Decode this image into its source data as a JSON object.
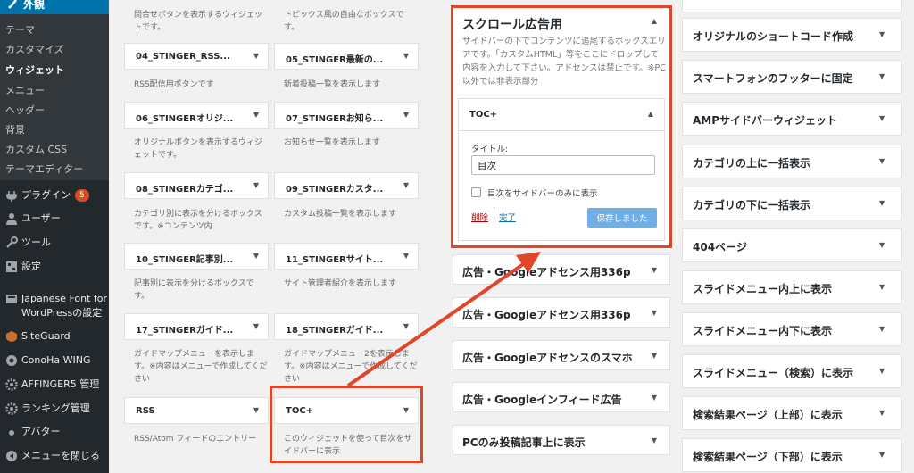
{
  "sidebar": {
    "header": "外観",
    "submenu": [
      "テーマ",
      "カスタマイズ",
      "ウィジェット",
      "メニュー",
      "ヘッダー",
      "背景",
      "カスタム CSS",
      "テーマエディター"
    ],
    "items": [
      {
        "label": "プラグイン",
        "badge": "5"
      },
      {
        "label": "ユーザー"
      },
      {
        "label": "ツール"
      },
      {
        "label": "設定"
      },
      {
        "label": "Japanese Font for",
        "label2": "WordPressの設定"
      },
      {
        "label": "SiteGuard"
      },
      {
        "label": "ConoHa WING"
      },
      {
        "label": "AFFINGER5 管理"
      },
      {
        "label": "ランキング管理"
      },
      {
        "label": "アバター"
      },
      {
        "label": "メニューを閉じる"
      }
    ]
  },
  "available": {
    "top_desc_left": "問合せボタンを表示するウィジェットです。",
    "top_desc_right": "トピックス風の自由なボックスです。",
    "widgets": [
      {
        "title": "04_STINGER_RSS...",
        "desc": "RSS配信用ボタンです"
      },
      {
        "title": "05_STINGER最新の...",
        "desc": "新着投稿一覧を表示します"
      },
      {
        "title": "06_STINGERオリジ...",
        "desc": "オリジナルボタンを表示するウィジェットです。"
      },
      {
        "title": "07_STINGERお知ら...",
        "desc": "お知らせ一覧を表示します"
      },
      {
        "title": "08_STINGERカテゴ...",
        "desc": "カテゴリ別に表示を分けるボックスです。※コンテンツ内"
      },
      {
        "title": "09_STINGERカスタ...",
        "desc": "カスタム投稿一覧を表示します"
      },
      {
        "title": "10_STINGER記事別...",
        "desc": "記事別に表示を分けるボックスです。"
      },
      {
        "title": "11_STINGERサイト...",
        "desc": "サイト管理者紹介を表示します"
      },
      {
        "title": "17_STINGERガイド...",
        "desc": "ガイドマップメニューを表示します。※内容はメニューで作成してください"
      },
      {
        "title": "18_STINGERガイド...",
        "desc": "ガイドマップメニュー2を表示します。※内容はメニューで作成してください"
      },
      {
        "title": "RSS",
        "desc": "RSS/Atom フィードのエントリー"
      },
      {
        "title": "TOC+",
        "desc": "このウィジェットを使って目次をサイドバーに表示"
      }
    ]
  },
  "area": {
    "title": "スクロール広告用",
    "desc": "サイドバーの下でコンテンツに追尾するボックスエリアです。「カスタムHTML」等をここにドロップして内容を入力して下さい。アドセンスは禁止です。※PC以外では非表示部分",
    "toc": {
      "title": "TOC+",
      "field_label": "タイトル:",
      "field_value": "目次",
      "checkbox_label": "目次をサイドバーのみに表示",
      "delete": "削除",
      "separator": "|",
      "done": "完了",
      "save": "保存しました"
    }
  },
  "middle_widgets": [
    "広告・Googleアドセンス用336p",
    "広告・Googleアドセンス用336p",
    "広告・Googleアドセンスのスマホ",
    "広告・Googleインフィード広告",
    "PCのみ投稿記事上に表示"
  ],
  "right_widgets": [
    "オリジナルのショートコード作成",
    "スマートフォンのフッターに固定",
    "AMPサイドバーウィジェット",
    "カテゴリの上に一括表示",
    "カテゴリの下に一括表示",
    "404ページ",
    "スライドメニュー内上に表示",
    "スライドメニュー内下に表示",
    "スライドメニュー（検索）に表示",
    "検索結果ページ（上部）に表示",
    "検索結果ページ（下部）に表示"
  ],
  "colors": {
    "sidebar_bg": "#23282d",
    "submenu_bg": "#32373c",
    "accent_blue": "#0073aa",
    "highlight_red": "#e0462a",
    "save_button": "#72aee6",
    "badge": "#d54e21"
  }
}
